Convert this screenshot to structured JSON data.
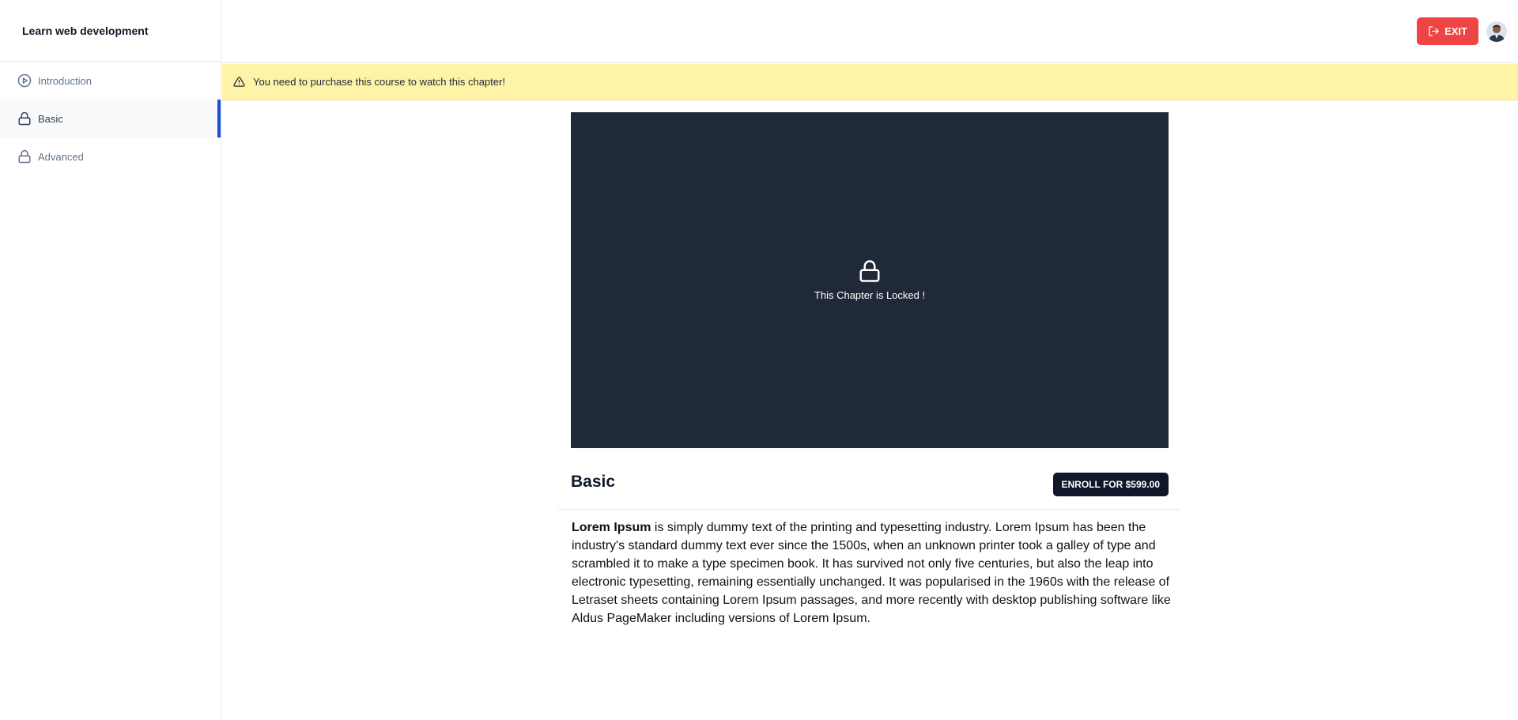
{
  "sidebar": {
    "course_title": "Learn web development",
    "chapters": [
      {
        "label": "Introduction",
        "icon": "play-circle-icon",
        "active": false
      },
      {
        "label": "Basic",
        "icon": "lock-icon",
        "active": true
      },
      {
        "label": "Advanced",
        "icon": "lock-icon",
        "active": false
      }
    ]
  },
  "topbar": {
    "exit_label": "EXIT",
    "exit_icon": "logout-icon",
    "avatar": "user-avatar"
  },
  "banner": {
    "icon": "alert-triangle-icon",
    "text": "You need to purchase this course to watch this chapter!"
  },
  "video": {
    "icon": "lock-icon",
    "locked_text": "This Chapter is Locked !"
  },
  "chapter": {
    "title": "Basic",
    "enroll_label": "ENROLL FOR $599.00",
    "description_bold": "Lorem Ipsum",
    "description_rest": " is simply dummy text of the printing and typesetting industry. Lorem Ipsum has been the industry's standard dummy text ever since the 1500s, when an unknown printer took a galley of type and scrambled it to make a type specimen book. It has survived not only five centuries, but also the leap into electronic typesetting, remaining essentially unchanged. It was popularised in the 1960s with the release of Letraset sheets containing Lorem Ipsum passages, and more recently with desktop publishing software like Aldus PageMaker including versions of Lorem Ipsum."
  },
  "colors": {
    "exit_button": "#ef4444",
    "banner_bg": "#fef3a7",
    "video_bg": "#1f2937",
    "active_indicator": "#1d4ed8",
    "enroll_button": "#0f172a"
  }
}
